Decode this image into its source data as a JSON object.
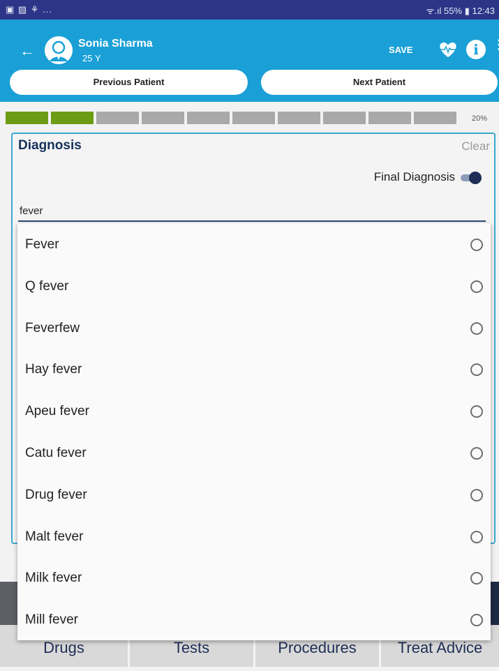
{
  "status_bar": {
    "left_icons": "▣ ▨ ⚘ ...",
    "right_text": "ᯤ.ıl 55% ▮ 12:43"
  },
  "header": {
    "patient_name": "Sonia Sharma",
    "patient_age": "25 Y",
    "save_label": "SAVE",
    "info_glyph": "i",
    "more_glyph": "⋮",
    "back_glyph": "←",
    "previous_label": "Previous Patient",
    "next_label": "Next Patient"
  },
  "progress": {
    "segments": 10,
    "completed": 2,
    "label": "20%"
  },
  "diagnosis": {
    "title": "Diagnosis",
    "clear_label": "Clear",
    "final_label": "Final Diagnosis",
    "final_enabled": true,
    "search_value": "fever"
  },
  "suggestions": [
    "Fever",
    "Q fever",
    "Feverfew",
    "Hay fever",
    "Apeu fever",
    "Catu fever",
    "Drug fever",
    "Malt fever",
    "Milk fever",
    "Mill fever"
  ],
  "bottom_tabs": [
    "Drugs",
    "Tests",
    "Procedures",
    "Treat Advice"
  ],
  "colors": {
    "header": "#1aa0d6",
    "status_bar": "#2c3587",
    "progress_done": "#6b9c14"
  }
}
